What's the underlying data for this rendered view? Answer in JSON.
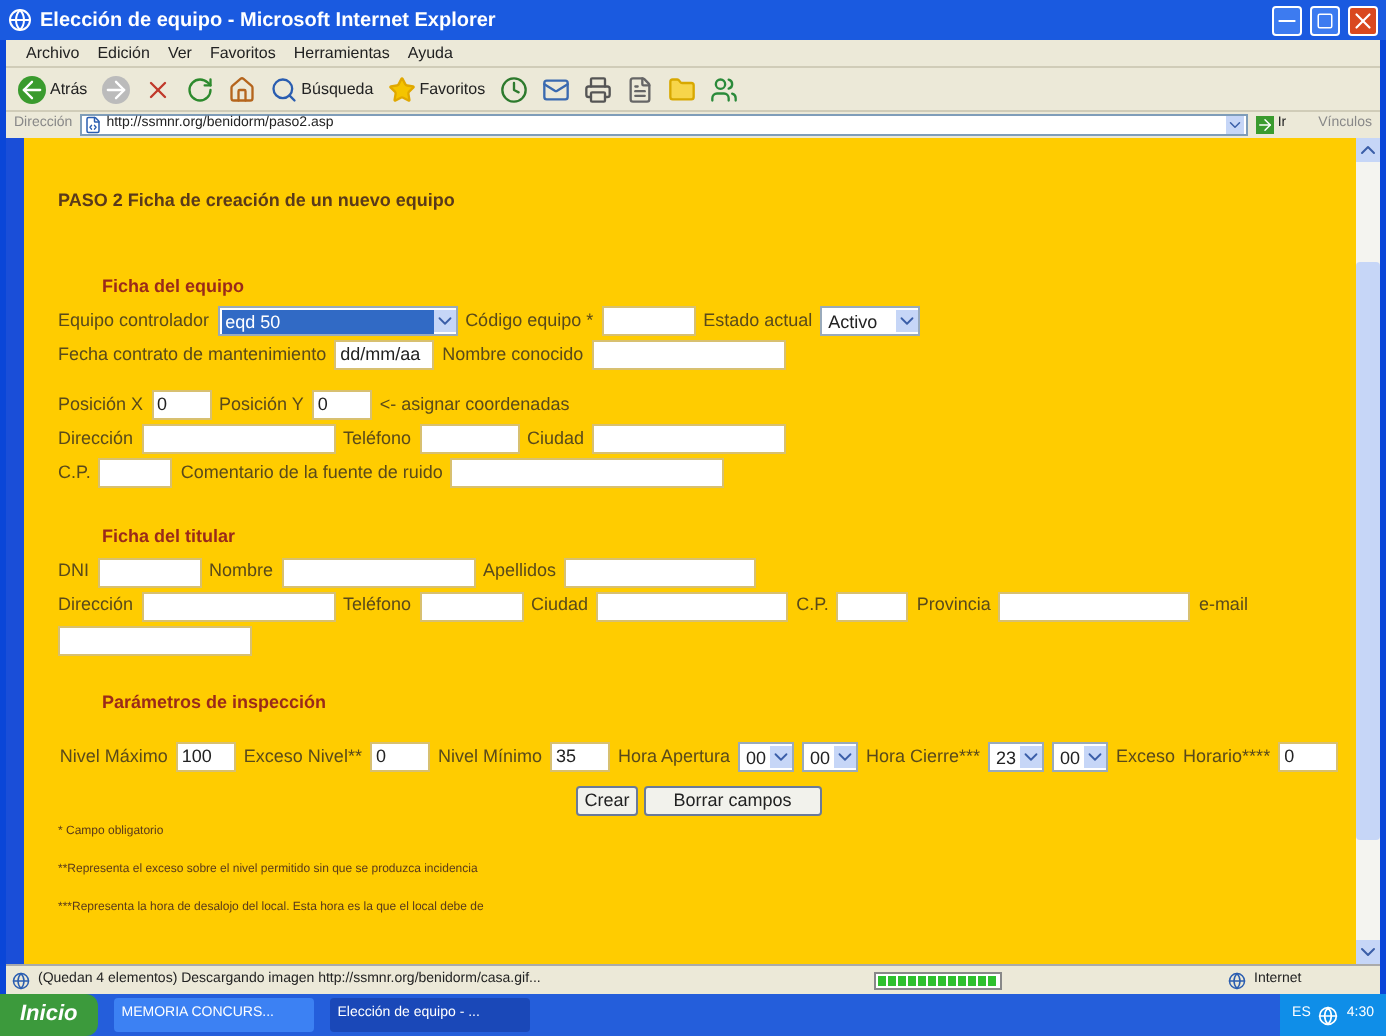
{
  "window": {
    "title": "Elección de equipo - Microsoft Internet Explorer"
  },
  "menu": [
    "Archivo",
    "Edición",
    "Ver",
    "Favoritos",
    "Herramientas",
    "Ayuda"
  ],
  "toolbar": [
    {
      "kind": "back",
      "label": "Atrás"
    },
    {
      "kind": "forward"
    },
    {
      "kind": "stop"
    },
    {
      "kind": "refresh"
    },
    {
      "kind": "home"
    },
    {
      "kind": "search",
      "label": "Búsqueda"
    },
    {
      "kind": "favorites",
      "label": "Favoritos"
    },
    {
      "kind": "history"
    },
    {
      "kind": "mail"
    },
    {
      "kind": "print"
    },
    {
      "kind": "edit"
    },
    {
      "kind": "folder"
    },
    {
      "kind": "messenger"
    }
  ],
  "address": {
    "label": "Dirección",
    "url": "http://ssmnr.org/benidorm/paso2.asp",
    "go": "Ir",
    "links": "Vínculos"
  },
  "page": {
    "heading": "PASO 2 Ficha de creación de un nuevo equipo",
    "sections": [
      {
        "title": "Ficha del equipo",
        "rows": [
          [
            {
              "kind": "label",
              "text": "Equipo controlador"
            },
            {
              "kind": "select",
              "value": "eqd 50",
              "highlighted": true
            },
            {
              "kind": "label",
              "text": "Código equipo *"
            },
            {
              "kind": "input"
            },
            {
              "kind": "label",
              "text": "Estado actual"
            },
            {
              "kind": "select",
              "value": "Activo",
              "highlighted": false
            }
          ],
          [
            {
              "kind": "label",
              "text": "Fecha contrato de mantenimiento"
            },
            {
              "kind": "input",
              "value": "dd/mm/aa"
            },
            {
              "kind": "label",
              "text": "Nombre conocido"
            },
            {
              "kind": "input"
            }
          ],
          [
            {
              "kind": "label",
              "text": "Posición X"
            },
            {
              "kind": "input",
              "value": "0"
            },
            {
              "kind": "label",
              "text": "Posición Y"
            },
            {
              "kind": "input",
              "value": "0"
            },
            {
              "kind": "label",
              "text": "<- asignar coordenadas"
            }
          ],
          [
            {
              "kind": "label",
              "text": "Dirección"
            },
            {
              "kind": "input"
            },
            {
              "kind": "label",
              "text": "Teléfono"
            },
            {
              "kind": "input"
            },
            {
              "kind": "label",
              "text": "Ciudad"
            },
            {
              "kind": "input"
            }
          ],
          [
            {
              "kind": "label",
              "text": "C.P."
            },
            {
              "kind": "input"
            },
            {
              "kind": "label",
              "text": "Comentario de la fuente de ruido"
            },
            {
              "kind": "input"
            }
          ]
        ]
      },
      {
        "title": "Ficha del titular",
        "rows": [
          [
            {
              "kind": "label",
              "text": "DNI"
            },
            {
              "kind": "input"
            },
            {
              "kind": "label",
              "text": "Nombre"
            },
            {
              "kind": "input"
            },
            {
              "kind": "label",
              "text": "Apellidos"
            },
            {
              "kind": "input"
            }
          ],
          [
            {
              "kind": "label",
              "text": "Dirección"
            },
            {
              "kind": "input"
            },
            {
              "kind": "label",
              "text": "Teléfono"
            },
            {
              "kind": "input"
            },
            {
              "kind": "label",
              "text": "Ciudad"
            },
            {
              "kind": "input"
            },
            {
              "kind": "label",
              "text": "C.P."
            },
            {
              "kind": "input"
            },
            {
              "kind": "label",
              "text": "Provincia"
            },
            {
              "kind": "input"
            },
            {
              "kind": "label",
              "text": "e-mail"
            },
            {
              "kind": "input"
            }
          ]
        ]
      },
      {
        "title": "Parámetros de inspección",
        "rows": [
          [
            {
              "kind": "label",
              "text": "Nivel Máximo"
            },
            {
              "kind": "input",
              "value": "100"
            },
            {
              "kind": "label",
              "text": "Exceso Nivel**"
            },
            {
              "kind": "input",
              "value": "0"
            },
            {
              "kind": "label",
              "text": "Nivel Mínimo"
            },
            {
              "kind": "input",
              "value": "35"
            },
            {
              "kind": "label",
              "text": "Hora Apertura"
            },
            {
              "kind": "select",
              "value": "00",
              "highlighted": false
            },
            {
              "kind": "select",
              "value": "00",
              "highlighted": false
            },
            {
              "kind": "label",
              "text": "Hora Cierre***"
            },
            {
              "kind": "select",
              "value": "23",
              "highlighted": false
            },
            {
              "kind": "select",
              "value": "00",
              "highlighted": false
            },
            {
              "kind": "label",
              "text": "Exceso"
            },
            {
              "kind": "label",
              "text": "Horario****"
            },
            {
              "kind": "input",
              "value": "0"
            }
          ]
        ]
      }
    ],
    "buttons": [
      "Crear",
      "Borrar campos"
    ],
    "notes": [
      "* Campo obligatorio",
      "**Representa el exceso sobre el nivel permitido sin que se produzca incidencia",
      "***Representa la hora de desalojo del local. Esta hora es la que el local debe de"
    ]
  },
  "status_bar": {
    "text": "(Quedan 4 elementos) Descargando imagen http://ssmnr.org/benidorm/casa.gif...",
    "level": 1,
    "zone": "Internet"
  },
  "taskbar": {
    "start": "Inicio",
    "tasks": [
      {
        "label": "MEMORIA CONCURS...",
        "selected": false
      },
      {
        "label": "Elección de equipo - ...",
        "selected": true
      }
    ],
    "language": "ES",
    "clock": "4:30"
  }
}
